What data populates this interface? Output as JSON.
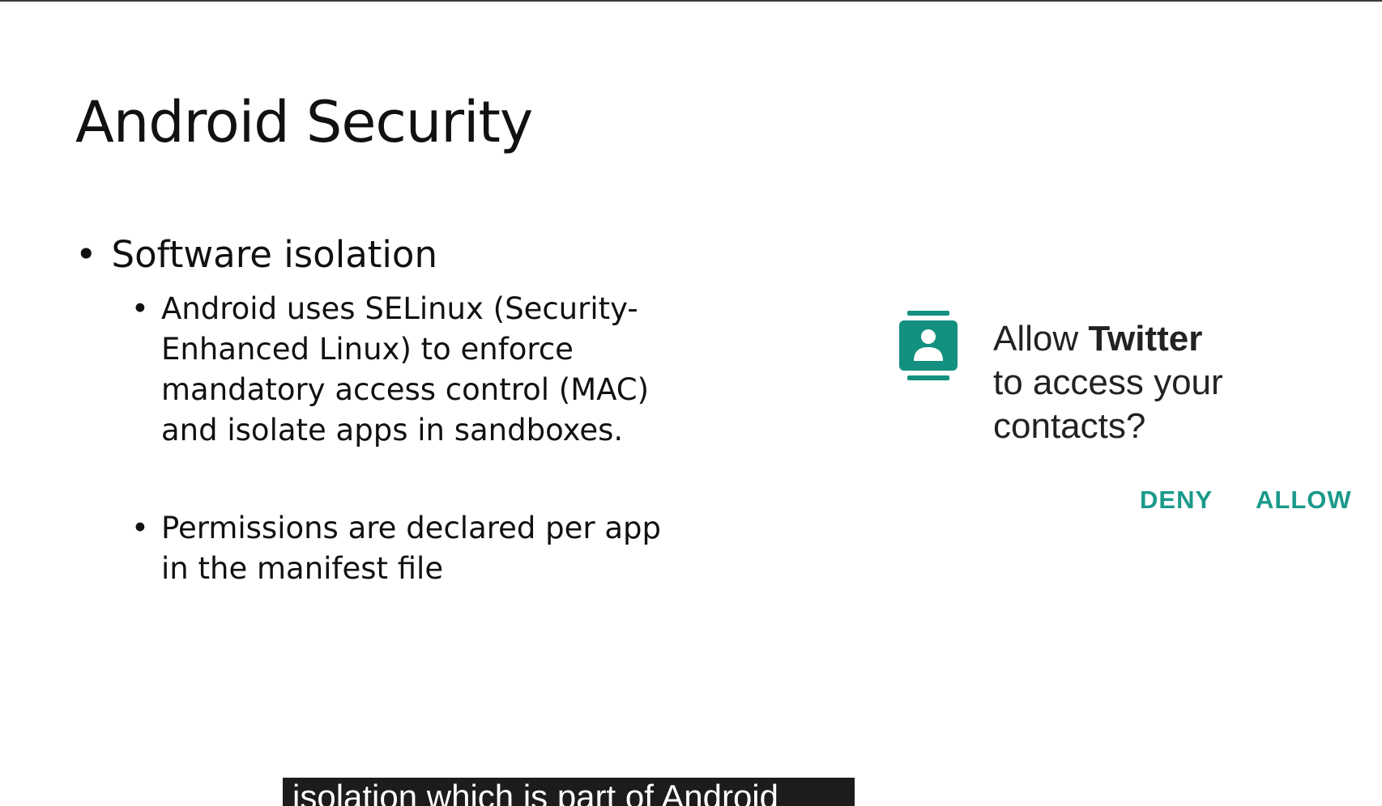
{
  "slide": {
    "title": "Android Security",
    "bullet_1": "Software isolation",
    "sub_bullets": [
      "Android uses SELinux (Security-\nEnhanced Linux) to enforce\nmandatory access control (MAC)\nand isolate apps in sandboxes.",
      "Permissions are declared per app\nin the manifest file"
    ],
    "bullet_glyph": "•"
  },
  "permission_dialog": {
    "icon": "contacts-icon",
    "prompt_prefix": "Allow ",
    "app_name": "Twitter",
    "prompt_line_2": "to access your",
    "prompt_line_3": "contacts?",
    "deny_label": "DENY",
    "allow_label": "ALLOW",
    "accent_color": "#1a9a8a",
    "icon_color": "#13907f"
  },
  "caption": {
    "text": "isolation which is part of Android"
  }
}
